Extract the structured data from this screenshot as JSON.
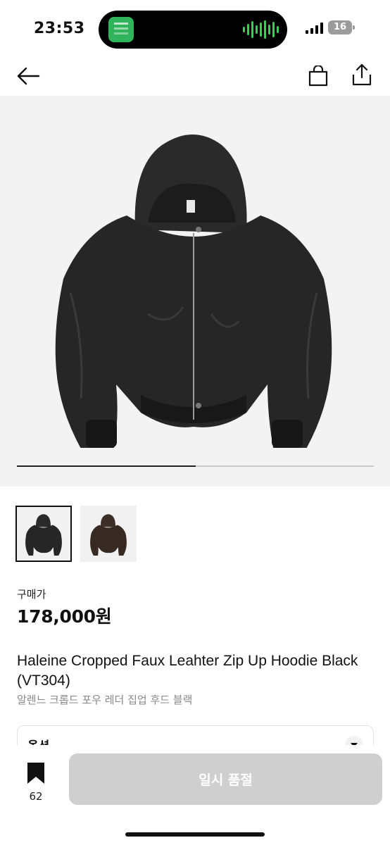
{
  "status_bar": {
    "time": "23:53",
    "battery": "16"
  },
  "header": {
    "back_icon": "arrow-left-icon",
    "cart_icon": "shopping-bag-icon",
    "share_icon": "share-icon"
  },
  "gallery": {
    "image_count": 2,
    "current_index": 1,
    "progress_fraction": 0.5,
    "thumbnails": [
      "black",
      "brown"
    ]
  },
  "price": {
    "label": "구매가",
    "value": "178,000원"
  },
  "product": {
    "title": "Haleine Cropped Faux Leahter Zip Up Hoodie Black (VT304)",
    "subtitle": "알렌느 크롭드 포우 레더 집업 후드 블랙"
  },
  "option": {
    "label": "옵션"
  },
  "bottom_bar": {
    "wish_count": "62",
    "soldout_label": "일시 품절"
  },
  "colors": {
    "accent": "#111111",
    "disabled_button": "#cfcfcf",
    "image_bg": "#f3f3f3"
  }
}
